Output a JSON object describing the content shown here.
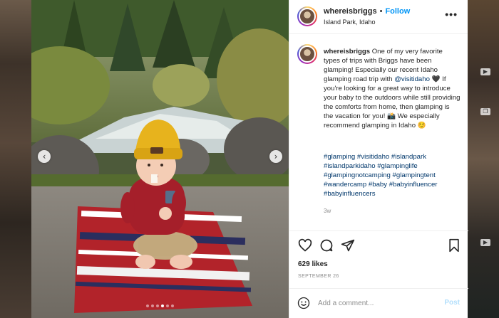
{
  "post": {
    "username": "whereisbriggs",
    "separator": "•",
    "follow_label": "Follow",
    "location": "Island Park, Idaho",
    "more_icon": "more-options-icon",
    "caption": {
      "username": "whereisbriggs",
      "text_1": " One of my very favorite types of trips with Briggs have been glamping! Especially our recent Idaho glamping road trip with ",
      "mention": "@visitidaho",
      "text_2": " 🖤 If you're looking for a great way to introduce your baby to the outdoors while still providing the comforts from home, then glamping is the vacation for you! 📸 We especially recommend glamping in Idaho ☺️"
    },
    "hashtags": "#glamping #visitidaho #islandpark #islandparkidaho #glampinglife #glampingnotcamping #glampingtent #wandercamp #baby #babyinfluencer #babyinfluencers",
    "time_ago": "3w",
    "likes": "629 likes",
    "date": "SEPTEMBER 26",
    "comment_placeholder": "Add a comment...",
    "post_label": "Post"
  },
  "media": {
    "prev_label": "‹",
    "next_label": "›",
    "carousel_count": 6,
    "active_index": 3
  },
  "colors": {
    "link_blue": "#0095f6",
    "mention": "#00376b",
    "muted": "#8e8e8e"
  }
}
